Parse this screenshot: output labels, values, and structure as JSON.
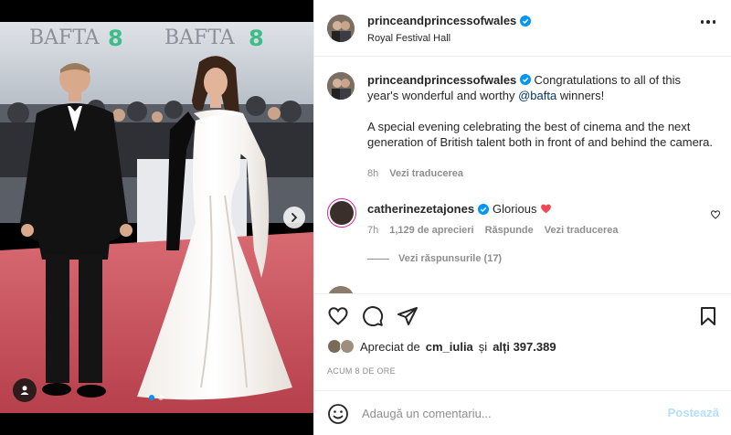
{
  "post": {
    "username": "princeandprincessofwales",
    "location": "Royal Festival Hall",
    "verified": true
  },
  "photo": {
    "backdrop_text_1": "BAFTA",
    "backdrop_text_2": "BAFTA",
    "backdrop_numeral_1": "8",
    "backdrop_numeral_2": "8",
    "slide_count": 2,
    "current_slide": 1
  },
  "caption": {
    "username": "princeandprincessofwales",
    "text_before_mention": "Congratulations to all of this year's wonderful and worthy",
    "mention": "@bafta",
    "text_after_mention": "winners!",
    "paragraph_2": "A special evening celebrating the best of cinema and the next generation of British talent both in front of and behind the camera.",
    "time": "8h",
    "translate": "Vezi traducerea"
  },
  "comment": {
    "username": "catherinezetajones",
    "verified": true,
    "text": "Glorious",
    "time": "7h",
    "likes": "1,129 de aprecieri",
    "reply": "Răspunde",
    "translate": "Vezi traducerea",
    "view_replies": "Vezi răspunsurile (17)"
  },
  "likes": {
    "prefix": "Apreciat de",
    "user": "cm_iulia",
    "conjunction": "și",
    "others": "alți 397.389"
  },
  "timestamp": "ACUM 8 DE ORE",
  "add_comment": {
    "placeholder": "Adaugă un comentariu...",
    "post_label": "Postează"
  },
  "colors": {
    "verified_blue": "#0095f6",
    "mention_blue": "#00376b",
    "heart_red": "#ed4956",
    "post_button_disabled": "#b2dffc",
    "carpet": "#c0505a"
  },
  "icons": [
    "more-icon",
    "heart-icon",
    "comment-icon",
    "share-icon",
    "bookmark-icon",
    "emoji-icon",
    "chevron-right-icon",
    "user-tag-icon",
    "verified-icon"
  ]
}
